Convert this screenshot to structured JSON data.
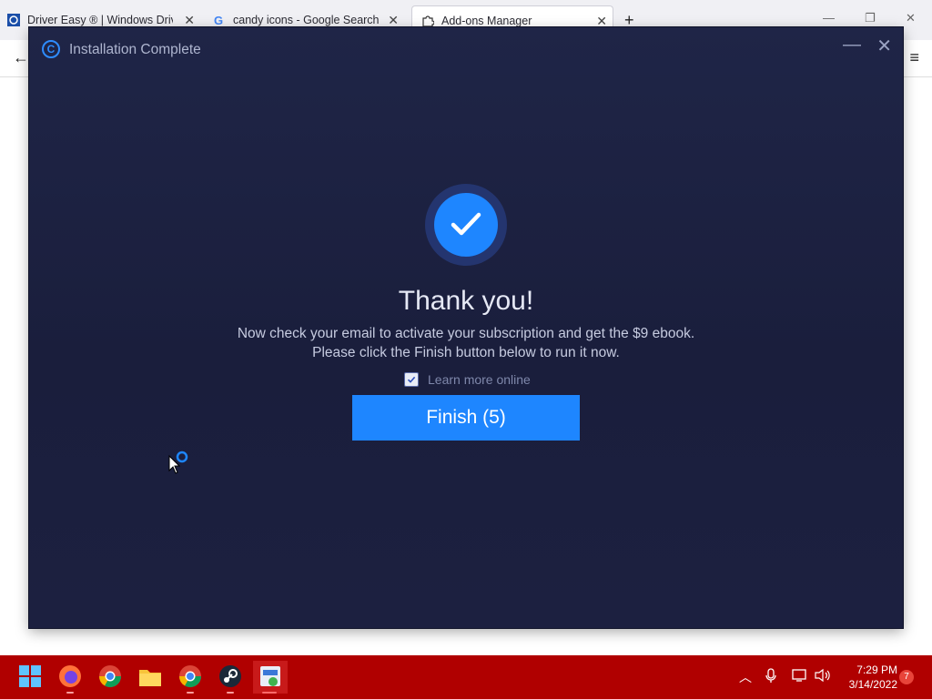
{
  "browser": {
    "tabs": [
      {
        "title": "Driver Easy ® | Windows Driver",
        "icon": "driver-easy-favicon"
      },
      {
        "title": "candy icons - Google Search",
        "icon": "google-favicon"
      },
      {
        "title": "Add-ons Manager",
        "icon": "puzzle-piece-icon"
      }
    ]
  },
  "dialog": {
    "title": "Installation Complete",
    "heading": "Thank you!",
    "message_line1": "Now check your email to activate your subscription and get the $9 ebook.",
    "message_line2": "Please click the Finish button below to run it now.",
    "learn_more": {
      "label": "Learn more online",
      "checked": true
    },
    "finish_button": "Finish (5)",
    "accent_color": "#1e86ff",
    "background_color": "#1f2547"
  },
  "taskbar": {
    "apps": [
      "windows-start-icon",
      "firefox-icon",
      "chrome-icon",
      "file-explorer-icon",
      "chrome-icon",
      "steam-icon",
      "driver-easy-installer-icon"
    ],
    "time": "7:29 PM",
    "date": "3/14/2022",
    "notification_count": "7",
    "background_color": "#b00000"
  }
}
